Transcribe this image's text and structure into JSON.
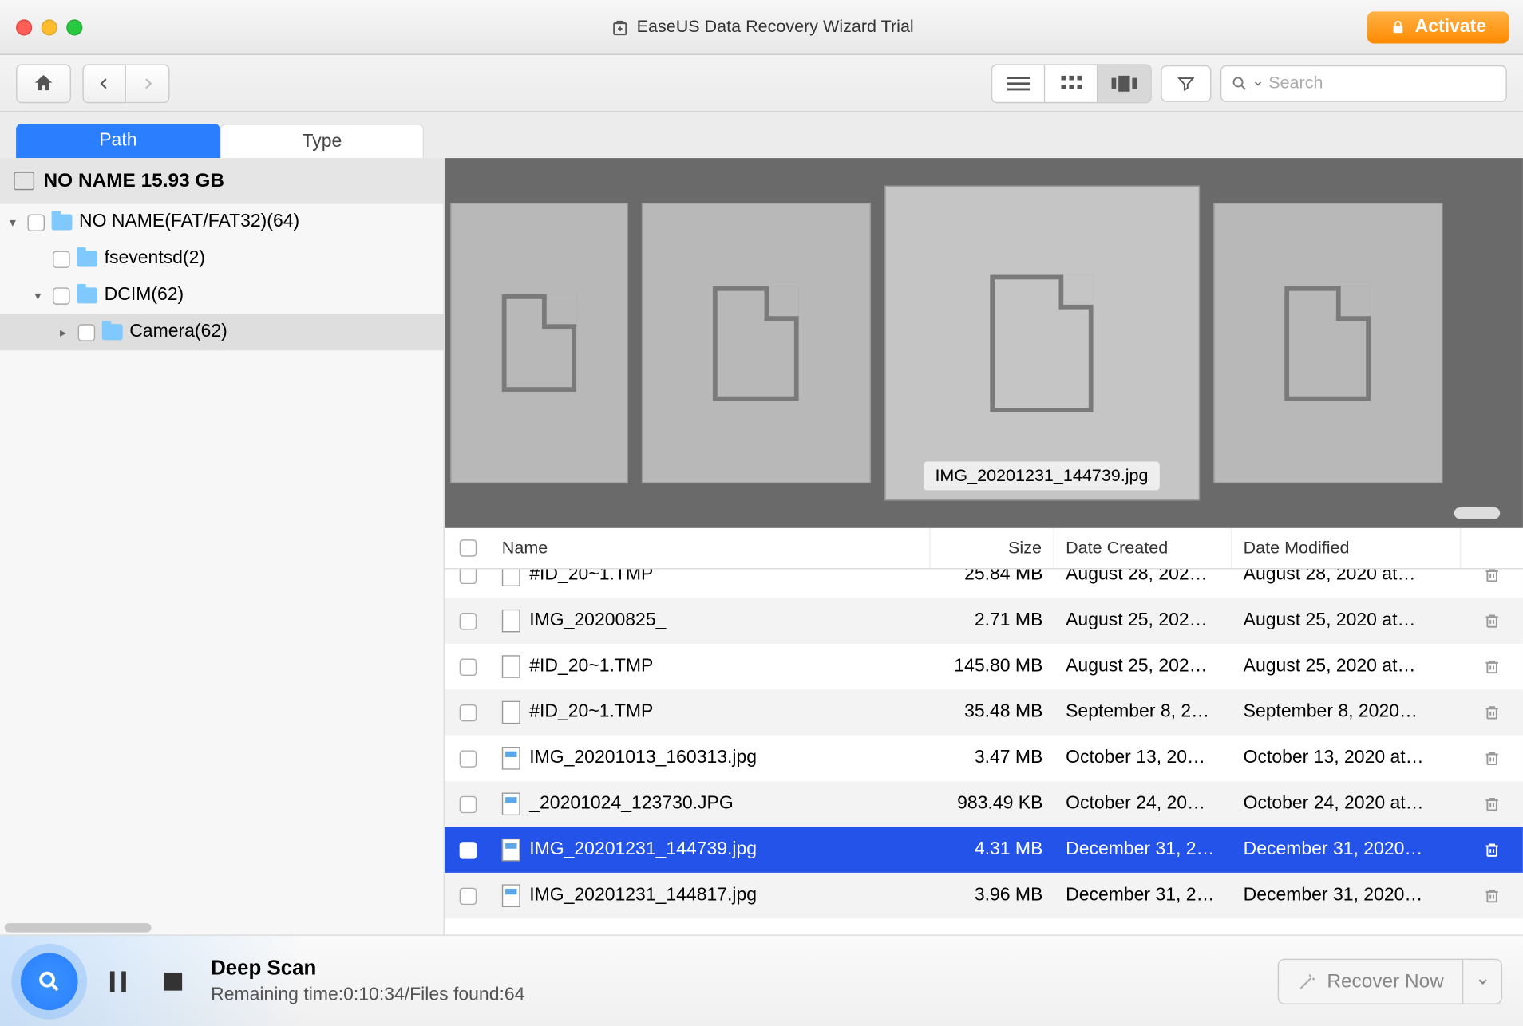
{
  "titlebar": {
    "app_title": "EaseUS Data Recovery Wizard Trial",
    "activate_label": "Activate"
  },
  "toolbar": {
    "search_placeholder": "Search"
  },
  "tabs": {
    "path_label": "Path",
    "type_label": "Type"
  },
  "sidebar": {
    "drive_label": "NO NAME 15.93 GB",
    "tree": [
      {
        "label": "NO NAME(FAT/FAT32)(64)",
        "indent": 0,
        "expanded": true,
        "selected": false
      },
      {
        "label": "fseventsd(2)",
        "indent": 1,
        "expanded": null,
        "selected": false
      },
      {
        "label": "DCIM(62)",
        "indent": 1,
        "expanded": true,
        "selected": false
      },
      {
        "label": "Camera(62)",
        "indent": 2,
        "expanded": false,
        "selected": true
      }
    ]
  },
  "preview": {
    "center_label": "IMG_20201231_144739.jpg"
  },
  "columns": {
    "name": "Name",
    "size": "Size",
    "created": "Date Created",
    "modified": "Date Modified"
  },
  "files": [
    {
      "name": "#ID_20~1.TMP",
      "size": "25.84 MB",
      "created": "August 28, 202…",
      "modified": "August 28, 2020 at…",
      "icon": "doc",
      "selected": false,
      "partial": true
    },
    {
      "name": "IMG_20200825_",
      "size": "2.71 MB",
      "created": "August 25, 202…",
      "modified": "August 25, 2020 at…",
      "icon": "doc",
      "selected": false
    },
    {
      "name": "#ID_20~1.TMP",
      "size": "145.80 MB",
      "created": "August 25, 202…",
      "modified": "August 25, 2020 at…",
      "icon": "doc",
      "selected": false
    },
    {
      "name": "#ID_20~1.TMP",
      "size": "35.48 MB",
      "created": "September 8, 2…",
      "modified": "September 8, 2020…",
      "icon": "doc",
      "selected": false
    },
    {
      "name": "IMG_20201013_160313.jpg",
      "size": "3.47 MB",
      "created": "October 13, 20…",
      "modified": "October 13, 2020 at…",
      "icon": "img",
      "selected": false
    },
    {
      "name": "_20201024_123730.JPG",
      "size": "983.49 KB",
      "created": "October 24, 20…",
      "modified": "October 24, 2020 at…",
      "icon": "img",
      "selected": false
    },
    {
      "name": "IMG_20201231_144739.jpg",
      "size": "4.31 MB",
      "created": "December 31, 2…",
      "modified": "December 31, 2020…",
      "icon": "img",
      "selected": true
    },
    {
      "name": "IMG_20201231_144817.jpg",
      "size": "3.96 MB",
      "created": "December 31, 2…",
      "modified": "December 31, 2020…",
      "icon": "img",
      "selected": false
    }
  ],
  "bottom": {
    "scan_title": "Deep Scan",
    "scan_sub": "Remaining time:0:10:34/Files found:64",
    "recover_label": "Recover Now"
  }
}
